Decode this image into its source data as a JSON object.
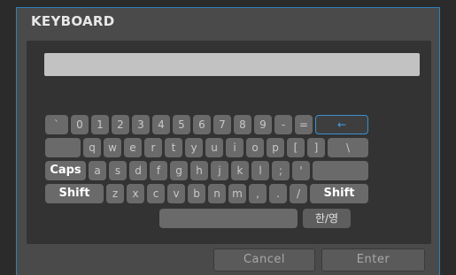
{
  "dialog": {
    "title": "KEYBOARD"
  },
  "input": {
    "value": ""
  },
  "rows": [
    [
      "`",
      "0",
      "1",
      "2",
      "3",
      "4",
      "5",
      "6",
      "7",
      "8",
      "9",
      "-",
      "=",
      "←"
    ],
    [
      "",
      "q",
      "w",
      "e",
      "r",
      "t",
      "y",
      "u",
      "i",
      "o",
      "p",
      "[",
      "]",
      "\\"
    ],
    [
      "Caps",
      "a",
      "s",
      "d",
      "f",
      "g",
      "h",
      "j",
      "k",
      "l",
      ";",
      "'",
      ""
    ],
    [
      "Shift",
      "z",
      "x",
      "c",
      "v",
      "b",
      "n",
      "m",
      ",",
      ".",
      "/",
      "Shift"
    ],
    [
      "",
      "한/영"
    ]
  ],
  "footer": {
    "cancel_label": "Cancel",
    "enter_label": "Enter"
  },
  "colors": {
    "accent": "#3d8fd0",
    "key_bg": "#6a6a6a",
    "panel_bg": "#333333"
  }
}
